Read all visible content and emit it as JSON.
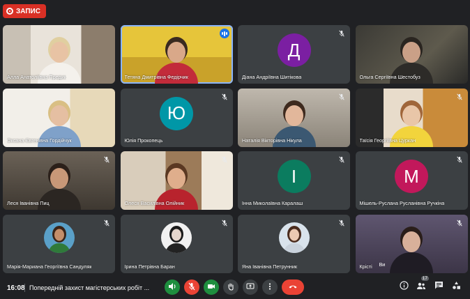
{
  "recording": {
    "label": "ЗАПИС"
  },
  "participants": [
    {
      "name": "Алла Анатоліївна Предик",
      "type": "video",
      "bg": "vid-shelf",
      "skin": "#e8c3a4",
      "shirt": "#f4f1ec",
      "hair": "#e0cfa0",
      "muted": false
    },
    {
      "name": "Тетяна Дмитрівна Федірчик",
      "type": "video",
      "bg": "vid-yellow",
      "skin": "#d9a889",
      "shirt": "#c22b3a",
      "hair": "#3a2a20",
      "muted": false,
      "speaking": true
    },
    {
      "name": "Діана Андріївна Шитікова",
      "type": "letter",
      "letter": "Д",
      "color": "#7b1fa2",
      "muted": true
    },
    {
      "name": "Ольга Сергіївна Шестобуз",
      "type": "video",
      "bg": "vid-dark",
      "skin": "#caa087",
      "shirt": "#2d2b28",
      "hair": "#2a2520",
      "muted": false
    },
    {
      "name": "Оксана Євгенівна Гордійчук",
      "type": "video",
      "bg": "vid-white",
      "skin": "#e5bfa2",
      "shirt": "#7fa1c9",
      "hair": "#d9bf84",
      "muted": false
    },
    {
      "name": "Юлія Прокопець",
      "type": "letter",
      "letter": "Ю",
      "color": "#0097a7",
      "muted": true
    },
    {
      "name": "Наталія Вікторівна Нікула",
      "type": "video",
      "bg": "vid-room",
      "skin": "#e2b79b",
      "shirt": "#3b5872",
      "hair": "#3e2a1e",
      "muted": true
    },
    {
      "name": "Таїсія Георгіївна Цуркан",
      "type": "video",
      "bg": "vid-orange",
      "skin": "#e9c6a8",
      "shirt": "#f2d43c",
      "hair": "#a0663a",
      "muted": true
    },
    {
      "name": "Леся Іванівна Пиц",
      "type": "video",
      "bg": "vid-grey",
      "skin": "#c89878",
      "shirt": "#2b2622",
      "hair": "#2b201a",
      "muted": true
    },
    {
      "name": "Олеся Василівна Олійник",
      "type": "video",
      "bg": "vid-door",
      "skin": "#dfae8c",
      "shirt": "#b8232d",
      "hair": "#5a3822",
      "muted": true
    },
    {
      "name": "Інна Миколаївна Каралаш",
      "type": "letter",
      "letter": "І",
      "color": "#0b7c5f",
      "muted": true
    },
    {
      "name": "Мішель-Руслана Русланівна Ручкіна",
      "type": "letter",
      "letter": "М",
      "color": "#c2185b",
      "muted": true
    },
    {
      "name": "Марія-Мариана Георгіївна Сандуляк",
      "type": "photo",
      "photoBg": "#5aa0c8",
      "skin": "#c48e6a",
      "shirt": "#2f7a3a",
      "hair": "#3a2418",
      "muted": true
    },
    {
      "name": "Ірина Петрівна Баран",
      "type": "photo",
      "photoBg": "#f1f1f1",
      "skin": "#e6d6cc",
      "shirt": "#222222",
      "hair": "#1a1a1a",
      "muted": true
    },
    {
      "name": "Яна Іванівна Петрунник",
      "type": "photo",
      "photoBg": "#d9e3ec",
      "skin": "#ecc9b2",
      "shirt": "#c9d2dc",
      "hair": "#4a2c1e",
      "muted": true
    },
    {
      "name": "Крісті",
      "type": "video",
      "bg": "vid-purple",
      "skin": "#d8b09a",
      "shirt": "#1f1c24",
      "hair": "#2a1e1a",
      "muted": true,
      "overlay": "Ви"
    }
  ],
  "bottom": {
    "time": "16:08",
    "meeting_title": "Попередній захист магістерських робіт ...",
    "people_count": "17"
  },
  "colors": {
    "background": "#202124",
    "tile": "#3c4043",
    "record": "#d93025",
    "hangup": "#ea4335",
    "green": "#1e8e3e",
    "accent": "#1a73e8"
  }
}
